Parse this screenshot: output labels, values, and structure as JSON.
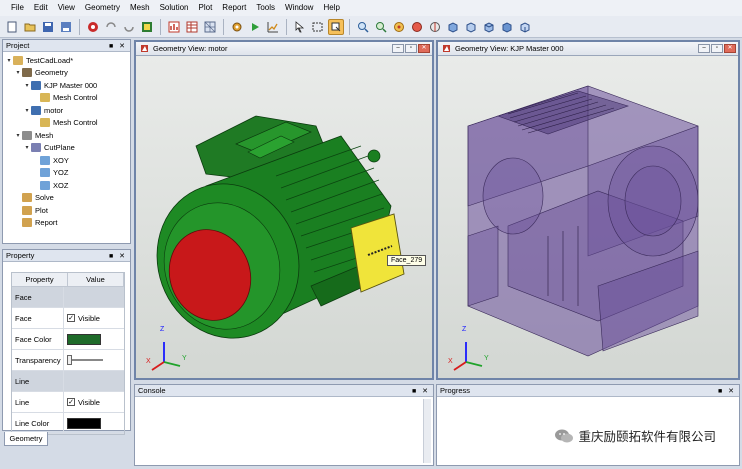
{
  "menubar": {
    "items": [
      "File",
      "Edit",
      "View",
      "Geometry",
      "Mesh",
      "Solution",
      "Plot",
      "Report",
      "Tools",
      "Window",
      "Help"
    ]
  },
  "toolbar": {
    "icons": [
      "new-file-icon",
      "open-folder-icon",
      "save-icon",
      "save-as-icon",
      "record-icon",
      "undo-icon",
      "redo-icon",
      "import-geometry-icon",
      "plot-icon",
      "report-table-icon",
      "mesh-icon",
      "solve-gear-icon",
      "run-icon",
      "graph-icon",
      "select-pointer-icon",
      "select-box-icon",
      "pick-icon",
      "zoom-icon",
      "zoom-fit-icon",
      "rotate-icon",
      "view-front-icon",
      "view-back-icon",
      "view-left-icon",
      "view-right-icon",
      "view-top-icon",
      "view-bottom-icon",
      "view-iso-icon"
    ],
    "active_index": 16
  },
  "project_panel": {
    "title": "Project",
    "controls": "■ ✕",
    "tree": [
      {
        "label": "TestCadLoad*",
        "level": 0,
        "toggle": "▾",
        "icon_color": "#d9b15a"
      },
      {
        "label": "Geometry",
        "level": 1,
        "toggle": "▾",
        "icon_color": "#7f6a4a"
      },
      {
        "label": "KJP Master 000",
        "level": 2,
        "toggle": "▾",
        "icon_color": "#3f6fb0"
      },
      {
        "label": "Mesh Control",
        "level": 3,
        "toggle": "",
        "icon_color": "#d8b656"
      },
      {
        "label": "motor",
        "level": 2,
        "toggle": "▾",
        "icon_color": "#3f6fb0"
      },
      {
        "label": "Mesh Control",
        "level": 3,
        "toggle": "",
        "icon_color": "#d8b656"
      },
      {
        "label": "Mesh",
        "level": 1,
        "toggle": "▾",
        "icon_color": "#8d8d8d"
      },
      {
        "label": "CutPlane",
        "level": 2,
        "toggle": "▾",
        "icon_color": "#7a7fb2"
      },
      {
        "label": "XOY",
        "level": 3,
        "toggle": "",
        "icon_color": "#6fa2d8"
      },
      {
        "label": "YOZ",
        "level": 3,
        "toggle": "",
        "icon_color": "#6fa2d8"
      },
      {
        "label": "XOZ",
        "level": 3,
        "toggle": "",
        "icon_color": "#6fa2d8"
      },
      {
        "label": "Solve",
        "level": 1,
        "toggle": "",
        "icon_color": "#d1a24f"
      },
      {
        "label": "Plot",
        "level": 1,
        "toggle": "",
        "icon_color": "#d1a24f"
      },
      {
        "label": "Report",
        "level": 1,
        "toggle": "",
        "icon_color": "#d1a24f"
      }
    ]
  },
  "property_panel": {
    "title": "Property",
    "controls": "■ ✕",
    "columns": [
      "Property",
      "Value"
    ],
    "rows": [
      {
        "name": "Face",
        "group": true
      },
      {
        "name": "Face",
        "checkbox": true,
        "value": "Visible"
      },
      {
        "name": "Face Color",
        "swatch": "#1f6b2a"
      },
      {
        "name": "Transparency",
        "slider": true
      },
      {
        "name": "Line",
        "group": true
      },
      {
        "name": "Line",
        "checkbox": true,
        "value": "Visible"
      },
      {
        "name": "Line Color",
        "swatch": "#000000"
      }
    ],
    "bottom_tab": "Geometry"
  },
  "view_left": {
    "title": "Geometry View: motor",
    "tooltip": "Face_279"
  },
  "view_right": {
    "title": "Geometry View: KJP Master 000"
  },
  "axis": {
    "z": "Z",
    "x": "X",
    "y": "Y"
  },
  "console": {
    "title": "Console",
    "controls": "■ ✕"
  },
  "progress": {
    "title": "Progress",
    "controls": "■ ✕"
  },
  "watermark": "重庆励颐拓软件有限公司",
  "colors": {
    "motor_green": "#1f8a25",
    "motor_red": "#c8181a",
    "motor_yellow": "#f0e43a",
    "gearbox_purple": "#6a4f9a",
    "view_frame": "#6f84a8"
  }
}
